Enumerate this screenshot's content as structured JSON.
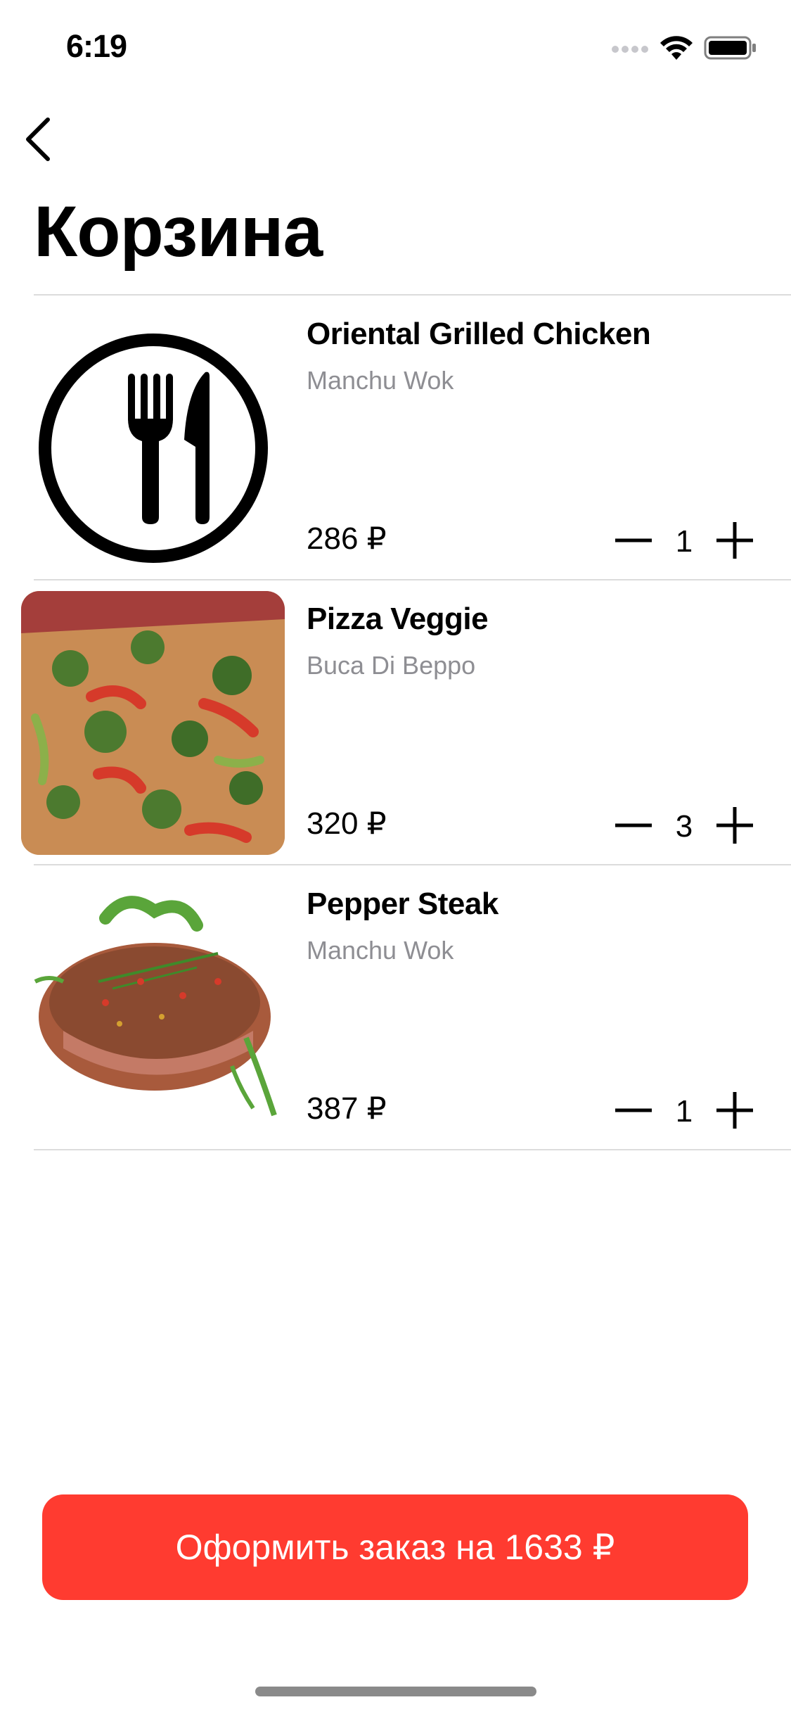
{
  "status_bar": {
    "time": "6:19",
    "icons": [
      "signal-icon",
      "wifi-icon",
      "battery-icon"
    ]
  },
  "nav": {
    "back_icon": "chevron-left-icon",
    "title": "Корзина"
  },
  "cart_items": [
    {
      "name": "Oriental Grilled Chicken",
      "restaurant": "Manchu Wok",
      "price": "286 ₽",
      "quantity": "1",
      "image": "fork-knife-plate-icon"
    },
    {
      "name": "Pizza Veggie",
      "restaurant": "Buca Di Beppo",
      "price": "320 ₽",
      "quantity": "3",
      "image": "pizza-photo"
    },
    {
      "name": "Pepper Steak",
      "restaurant": "Manchu Wok",
      "price": "387 ₽",
      "quantity": "1",
      "image": "steak-photo"
    }
  ],
  "order_button": {
    "label": "Оформить заказ на 1633 ₽"
  },
  "colors": {
    "accent": "#ff3b30",
    "secondary_text": "#8e8e93",
    "divider": "#dcdcdc"
  }
}
